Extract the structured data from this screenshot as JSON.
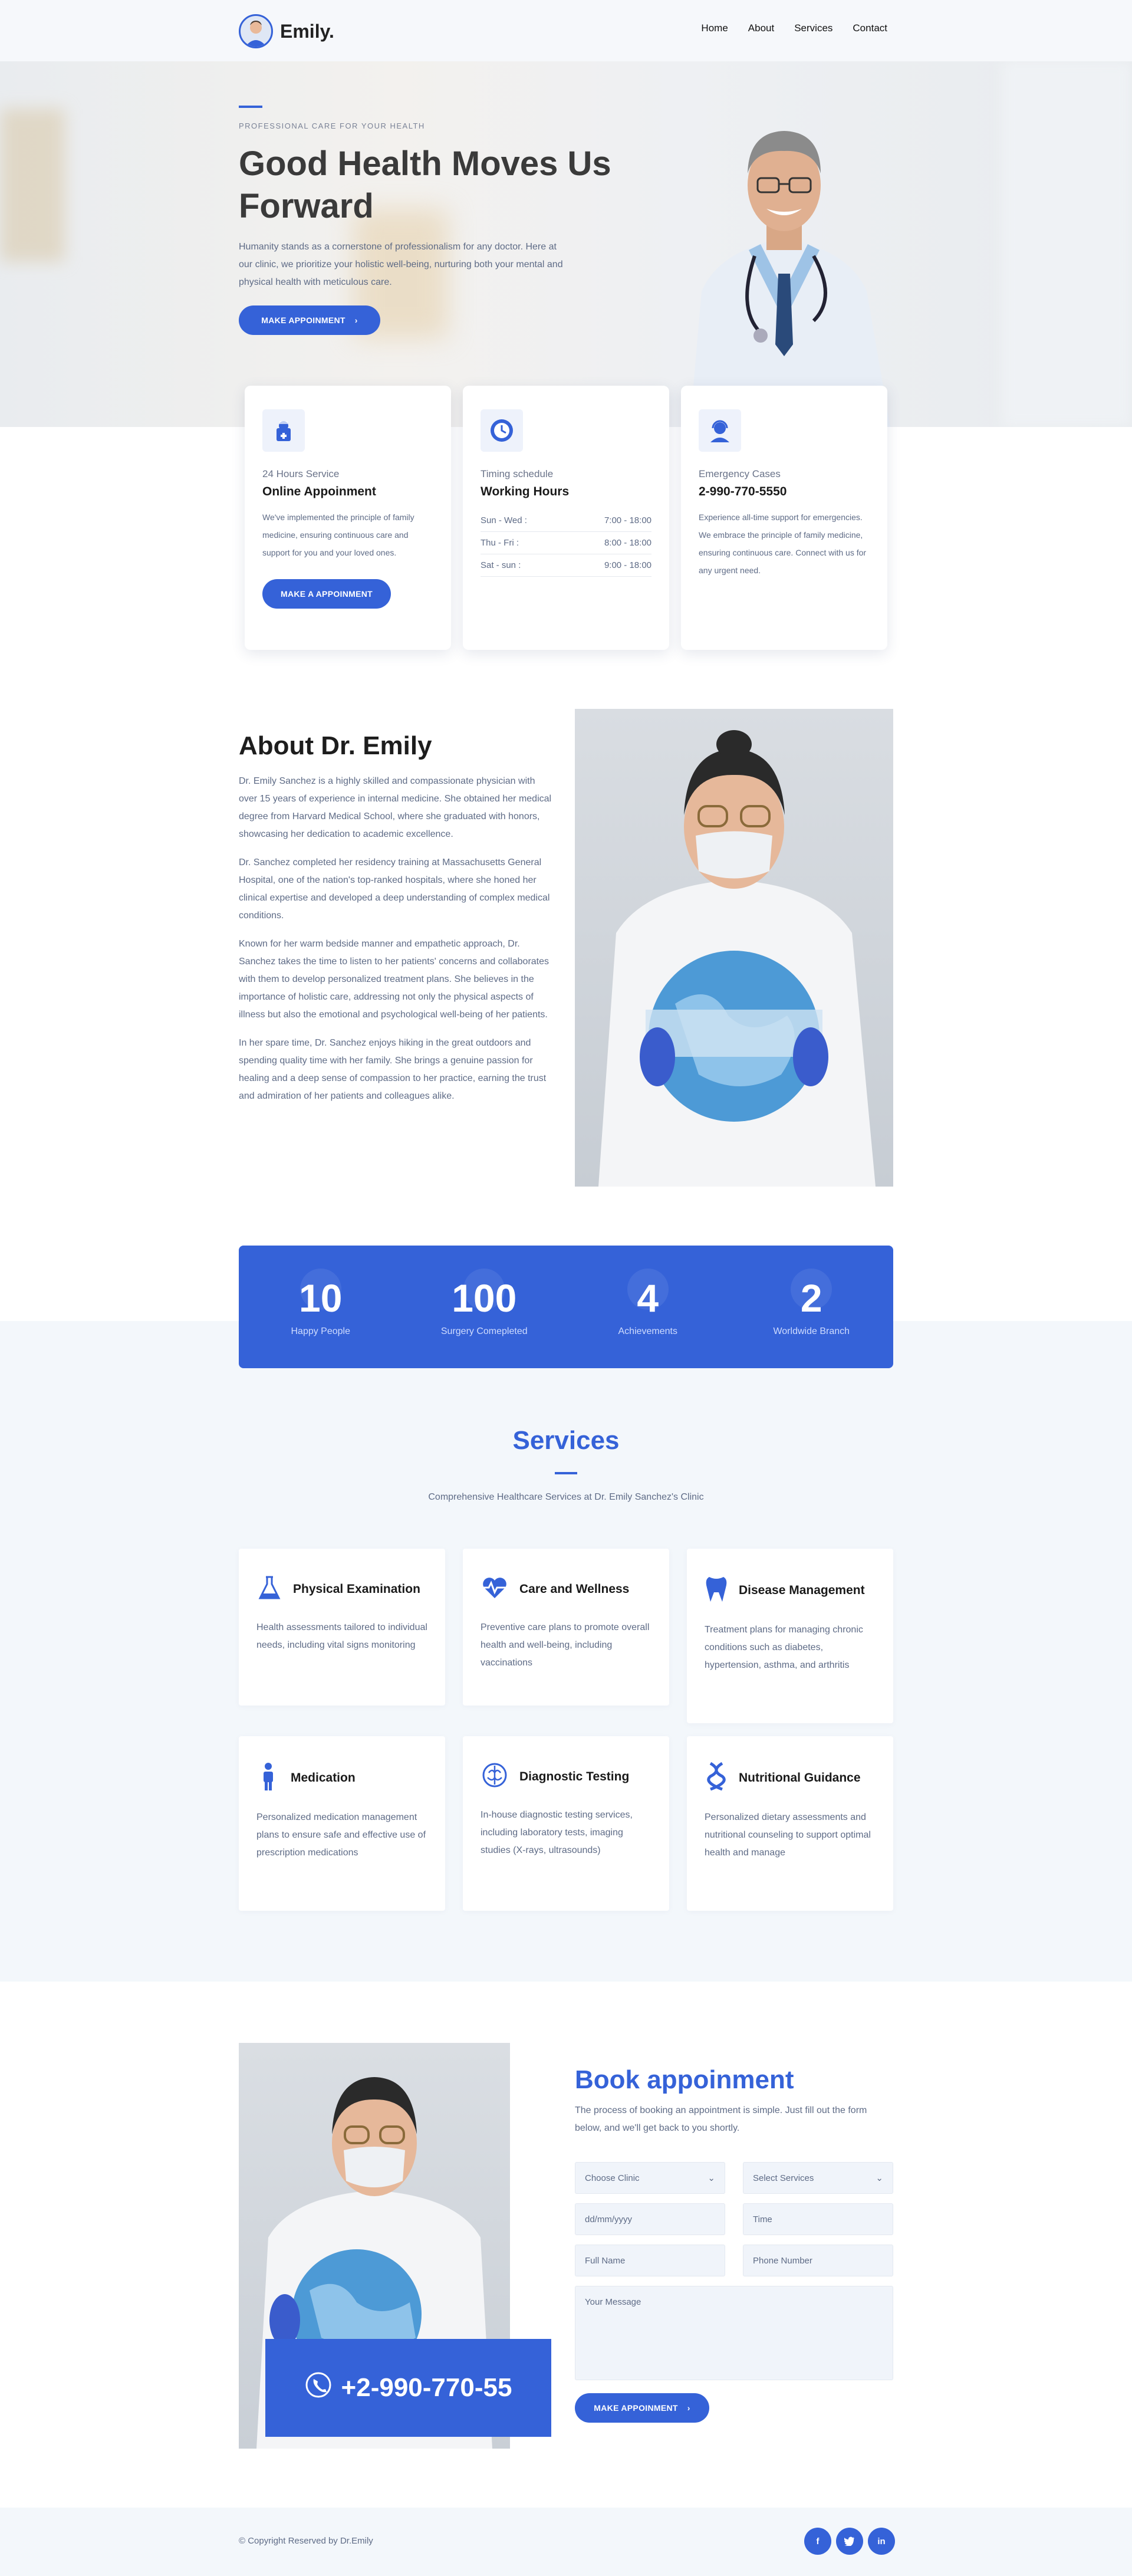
{
  "header": {
    "logo_text": "Emily.",
    "nav": [
      "Home",
      "About",
      "Services",
      "Contact"
    ]
  },
  "hero": {
    "eyebrow": "PROFESSIONAL CARE FOR YOUR HEALTH",
    "title": "Good Health Moves Us Forward",
    "text": "Humanity stands as a cornerstone of professionalism for any doctor. Here at our clinic, we prioritize your holistic well-being, nurturing both your mental and physical health with meticulous care.",
    "button": "MAKE APPOINMENT"
  },
  "cards": {
    "online": {
      "sub": "24 Hours Service",
      "title": "Online Appoinment",
      "text": "We've implemented the principle of family medicine, ensuring continuous care and support for you and your loved ones.",
      "button": "MAKE A APPOINMENT"
    },
    "timing": {
      "sub": "Timing schedule",
      "title": "Working Hours",
      "rows": [
        {
          "day": "Sun - Wed :",
          "time": "7:00 - 18:00"
        },
        {
          "day": "Thu - Fri :",
          "time": "8:00 - 18:00"
        },
        {
          "day": "Sat - sun :",
          "time": "9:00 - 18:00"
        }
      ]
    },
    "emergency": {
      "sub": "Emergency Cases",
      "title": "2-990-770-5550",
      "text": "Experience all-time support for emergencies. We embrace the principle of family medicine, ensuring continuous care. Connect with us for any urgent need."
    }
  },
  "about": {
    "title": "About Dr. Emily",
    "paragraphs": [
      "Dr. Emily Sanchez is a highly skilled and compassionate physician with over 15 years of experience in internal medicine. She obtained her medical degree from Harvard Medical School, where she graduated with honors, showcasing her dedication to academic excellence.",
      "Dr. Sanchez completed her residency training at Massachusetts General Hospital, one of the nation's top-ranked hospitals, where she honed her clinical expertise and developed a deep understanding of complex medical conditions.",
      "Known for her warm bedside manner and empathetic approach, Dr. Sanchez takes the time to listen to her patients' concerns and collaborates with them to develop personalized treatment plans. She believes in the importance of holistic care, addressing not only the physical aspects of illness but also the emotional and psychological well-being of her patients.",
      "In her spare time, Dr. Sanchez enjoys hiking in the great outdoors and spending quality time with her family. She brings a genuine passion for healing and a deep sense of compassion to her practice, earning the trust and admiration of her patients and colleagues alike."
    ]
  },
  "stats": [
    {
      "value": "10",
      "label": "Happy People"
    },
    {
      "value": "100",
      "label": "Surgery Comepleted"
    },
    {
      "value": "4",
      "label": "Achievements"
    },
    {
      "value": "2",
      "label": "Worldwide Branch"
    }
  ],
  "services": {
    "title": "Services",
    "subtitle": "Comprehensive Healthcare Services at Dr. Emily Sanchez's Clinic",
    "items": [
      {
        "icon": "flask-icon",
        "name": "Physical Examination",
        "text": "Health assessments tailored to individual needs, including vital signs monitoring"
      },
      {
        "icon": "heartbeat-icon",
        "name": "Care and Wellness",
        "text": "Preventive care plans to promote overall health and well-being, including vaccinations"
      },
      {
        "icon": "tooth-icon",
        "name": "Disease Management",
        "text": "Treatment plans for managing chronic conditions such as diabetes, hypertension, asthma, and arthritis"
      },
      {
        "icon": "person-icon",
        "name": "Medication",
        "text": "Personalized medication management plans to ensure safe and effective use of prescription medications"
      },
      {
        "icon": "brain-icon",
        "name": "Diagnostic Testing",
        "text": "In-house diagnostic testing services, including laboratory tests, imaging studies (X-rays, ultrasounds)"
      },
      {
        "icon": "dna-icon",
        "name": "Nutritional Guidance",
        "text": "Personalized dietary assessments and nutritional counseling to support optimal health and manage"
      }
    ]
  },
  "booking": {
    "phone": "+2-990-770-55",
    "title": "Book appoinment",
    "text": "The process of booking an appointment is simple. Just fill out the form below, and we'll get back to you shortly.",
    "clinic_select": "Choose Clinic",
    "service_select": "Select Services",
    "date_placeholder": "dd/mm/yyyy",
    "time_placeholder": "Time",
    "name_placeholder": "Full Name",
    "phone_placeholder": "Phone Number",
    "message_placeholder": "Your Message",
    "button": "MAKE APPOINMENT"
  },
  "footer": {
    "copyright": "© Copyright Reserved by Dr.Emily",
    "socials": [
      "facebook-icon",
      "twitter-icon",
      "linkedin-icon"
    ]
  },
  "colors": {
    "accent": "#3562d8",
    "text_muted": "#5e6b86",
    "section_bg": "#f3f7fb"
  }
}
